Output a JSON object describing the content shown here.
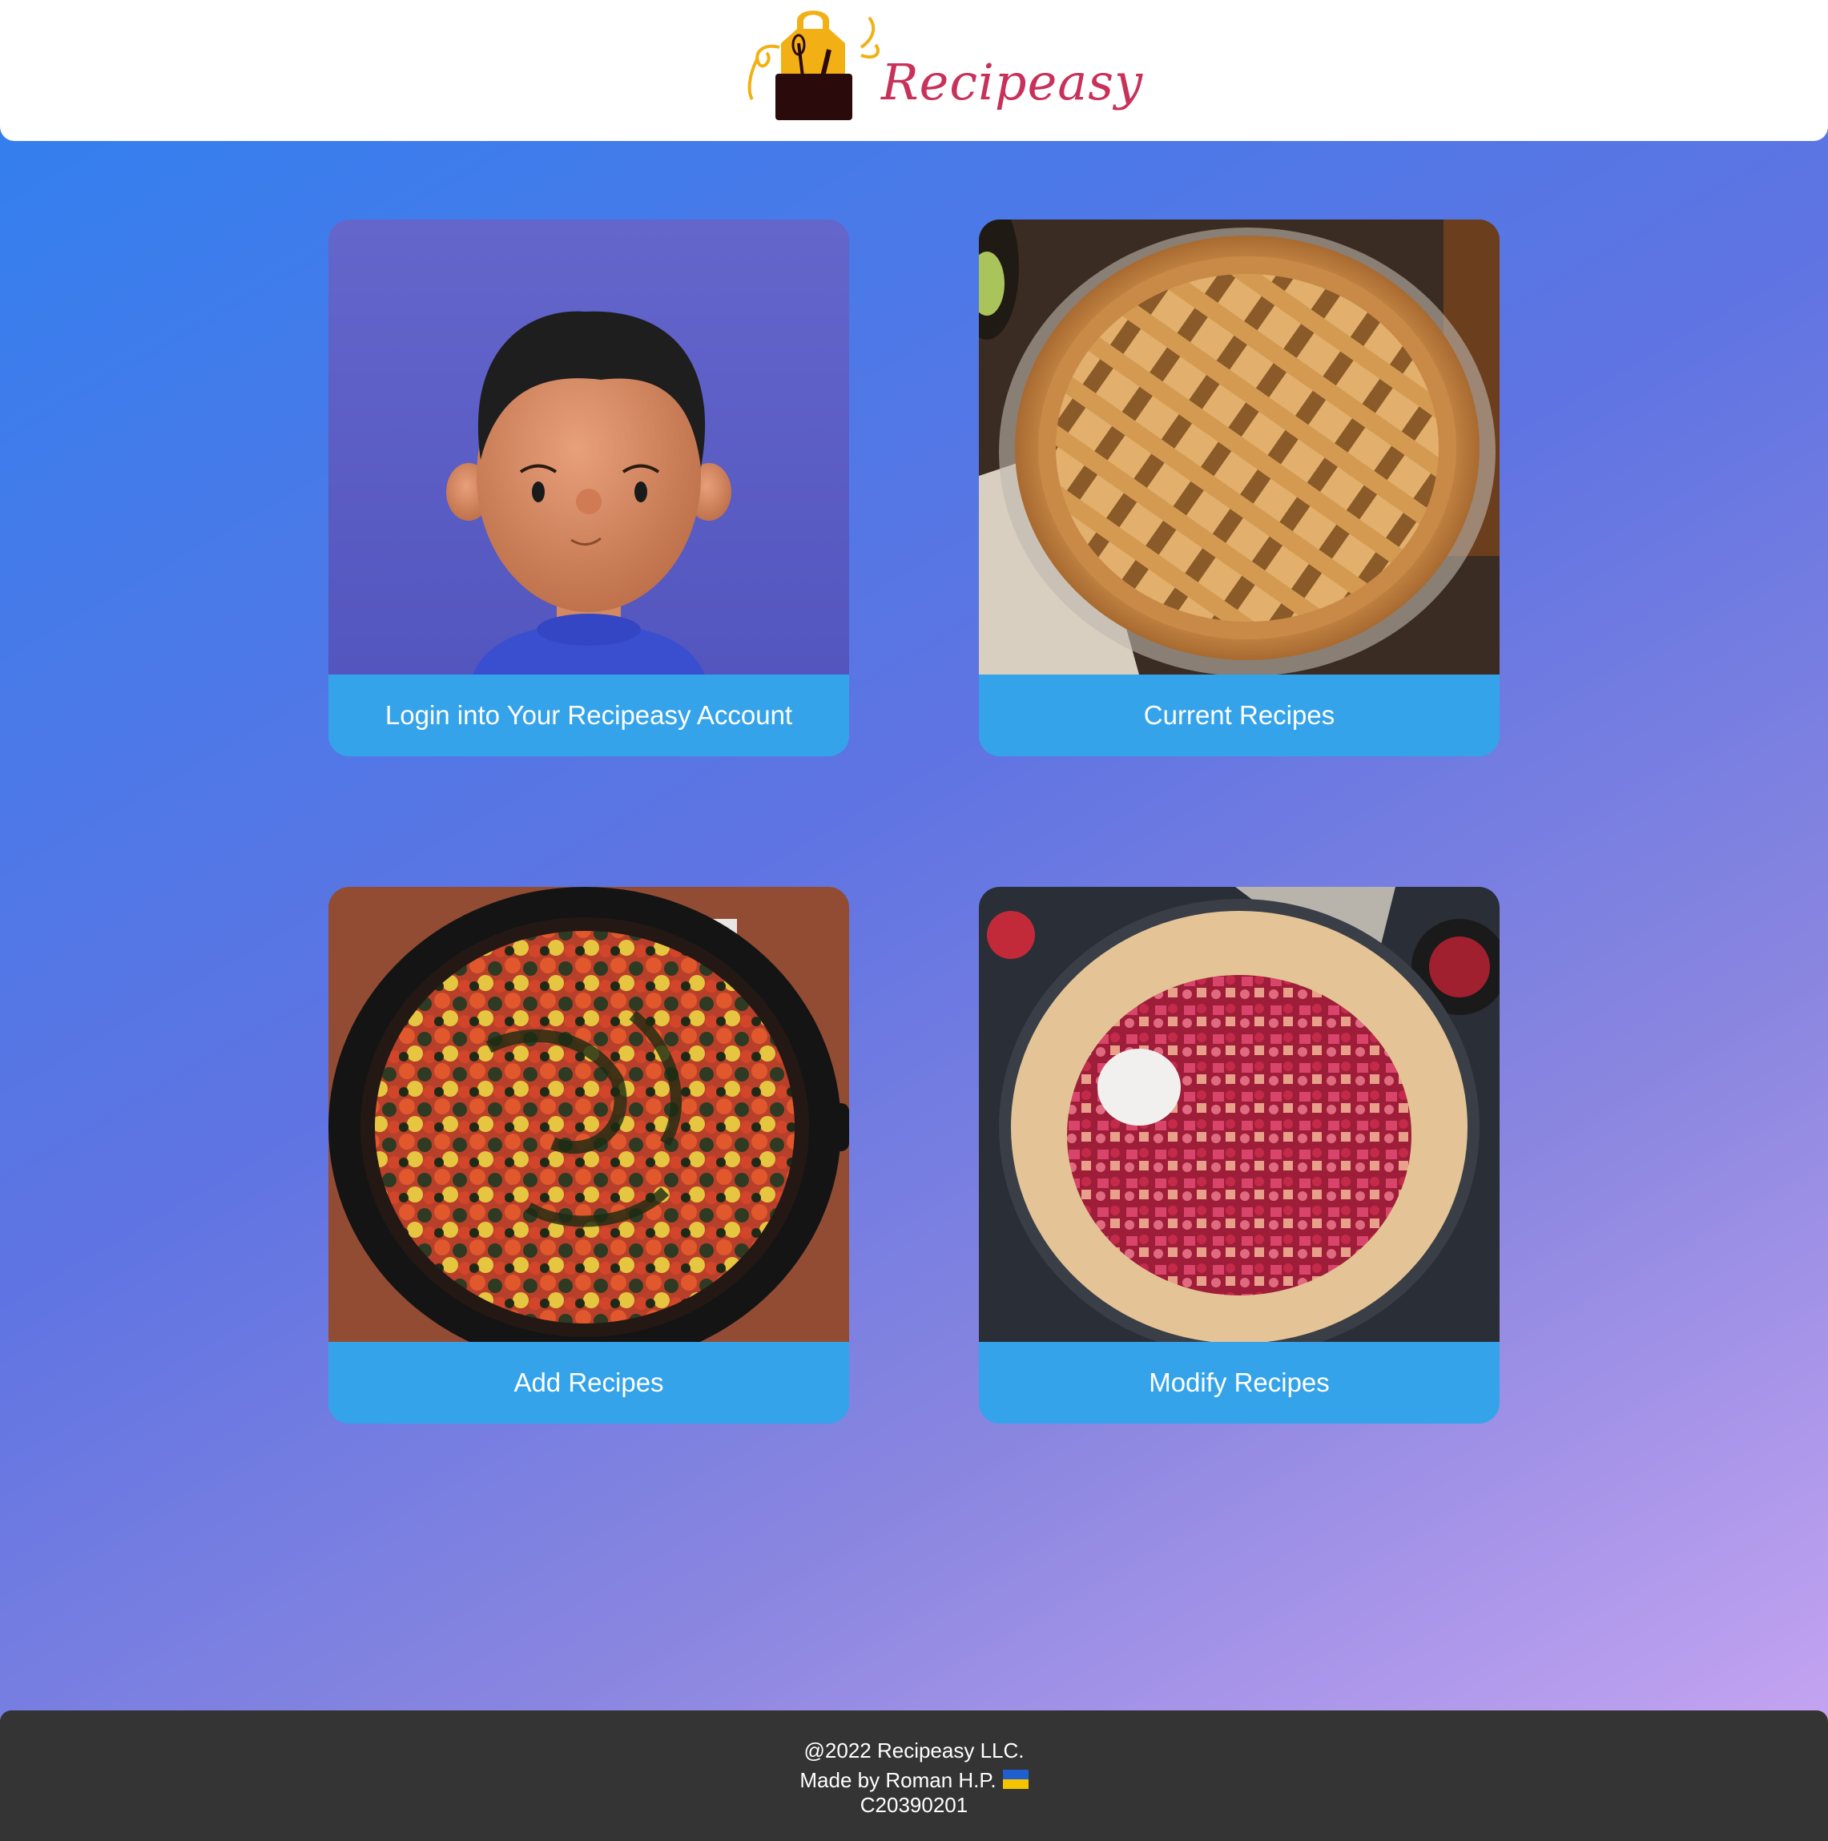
{
  "header": {
    "brand": "Recipeasy",
    "logo_icon": "apron-logo-icon"
  },
  "cards": [
    {
      "id": "login",
      "label": "Login into Your Recipeasy Account",
      "image": "avatar-illustration"
    },
    {
      "id": "current",
      "label": "Current Recipes",
      "image": "lattice-pie-photo"
    },
    {
      "id": "add",
      "label": "Add Recipes",
      "image": "ratatouille-photo"
    },
    {
      "id": "modify",
      "label": "Modify Recipes",
      "image": "strawberry-galette-photo"
    }
  ],
  "footer": {
    "copyright": "@2022 Recipeasy LLC.",
    "made_by": "Made by Roman H.P.",
    "code": "C20390201",
    "flag": "ukraine-flag-icon"
  },
  "colors": {
    "card_label_bg": "#35a3ea",
    "brand_text": "#c7315a",
    "footer_bg": "#343434"
  }
}
